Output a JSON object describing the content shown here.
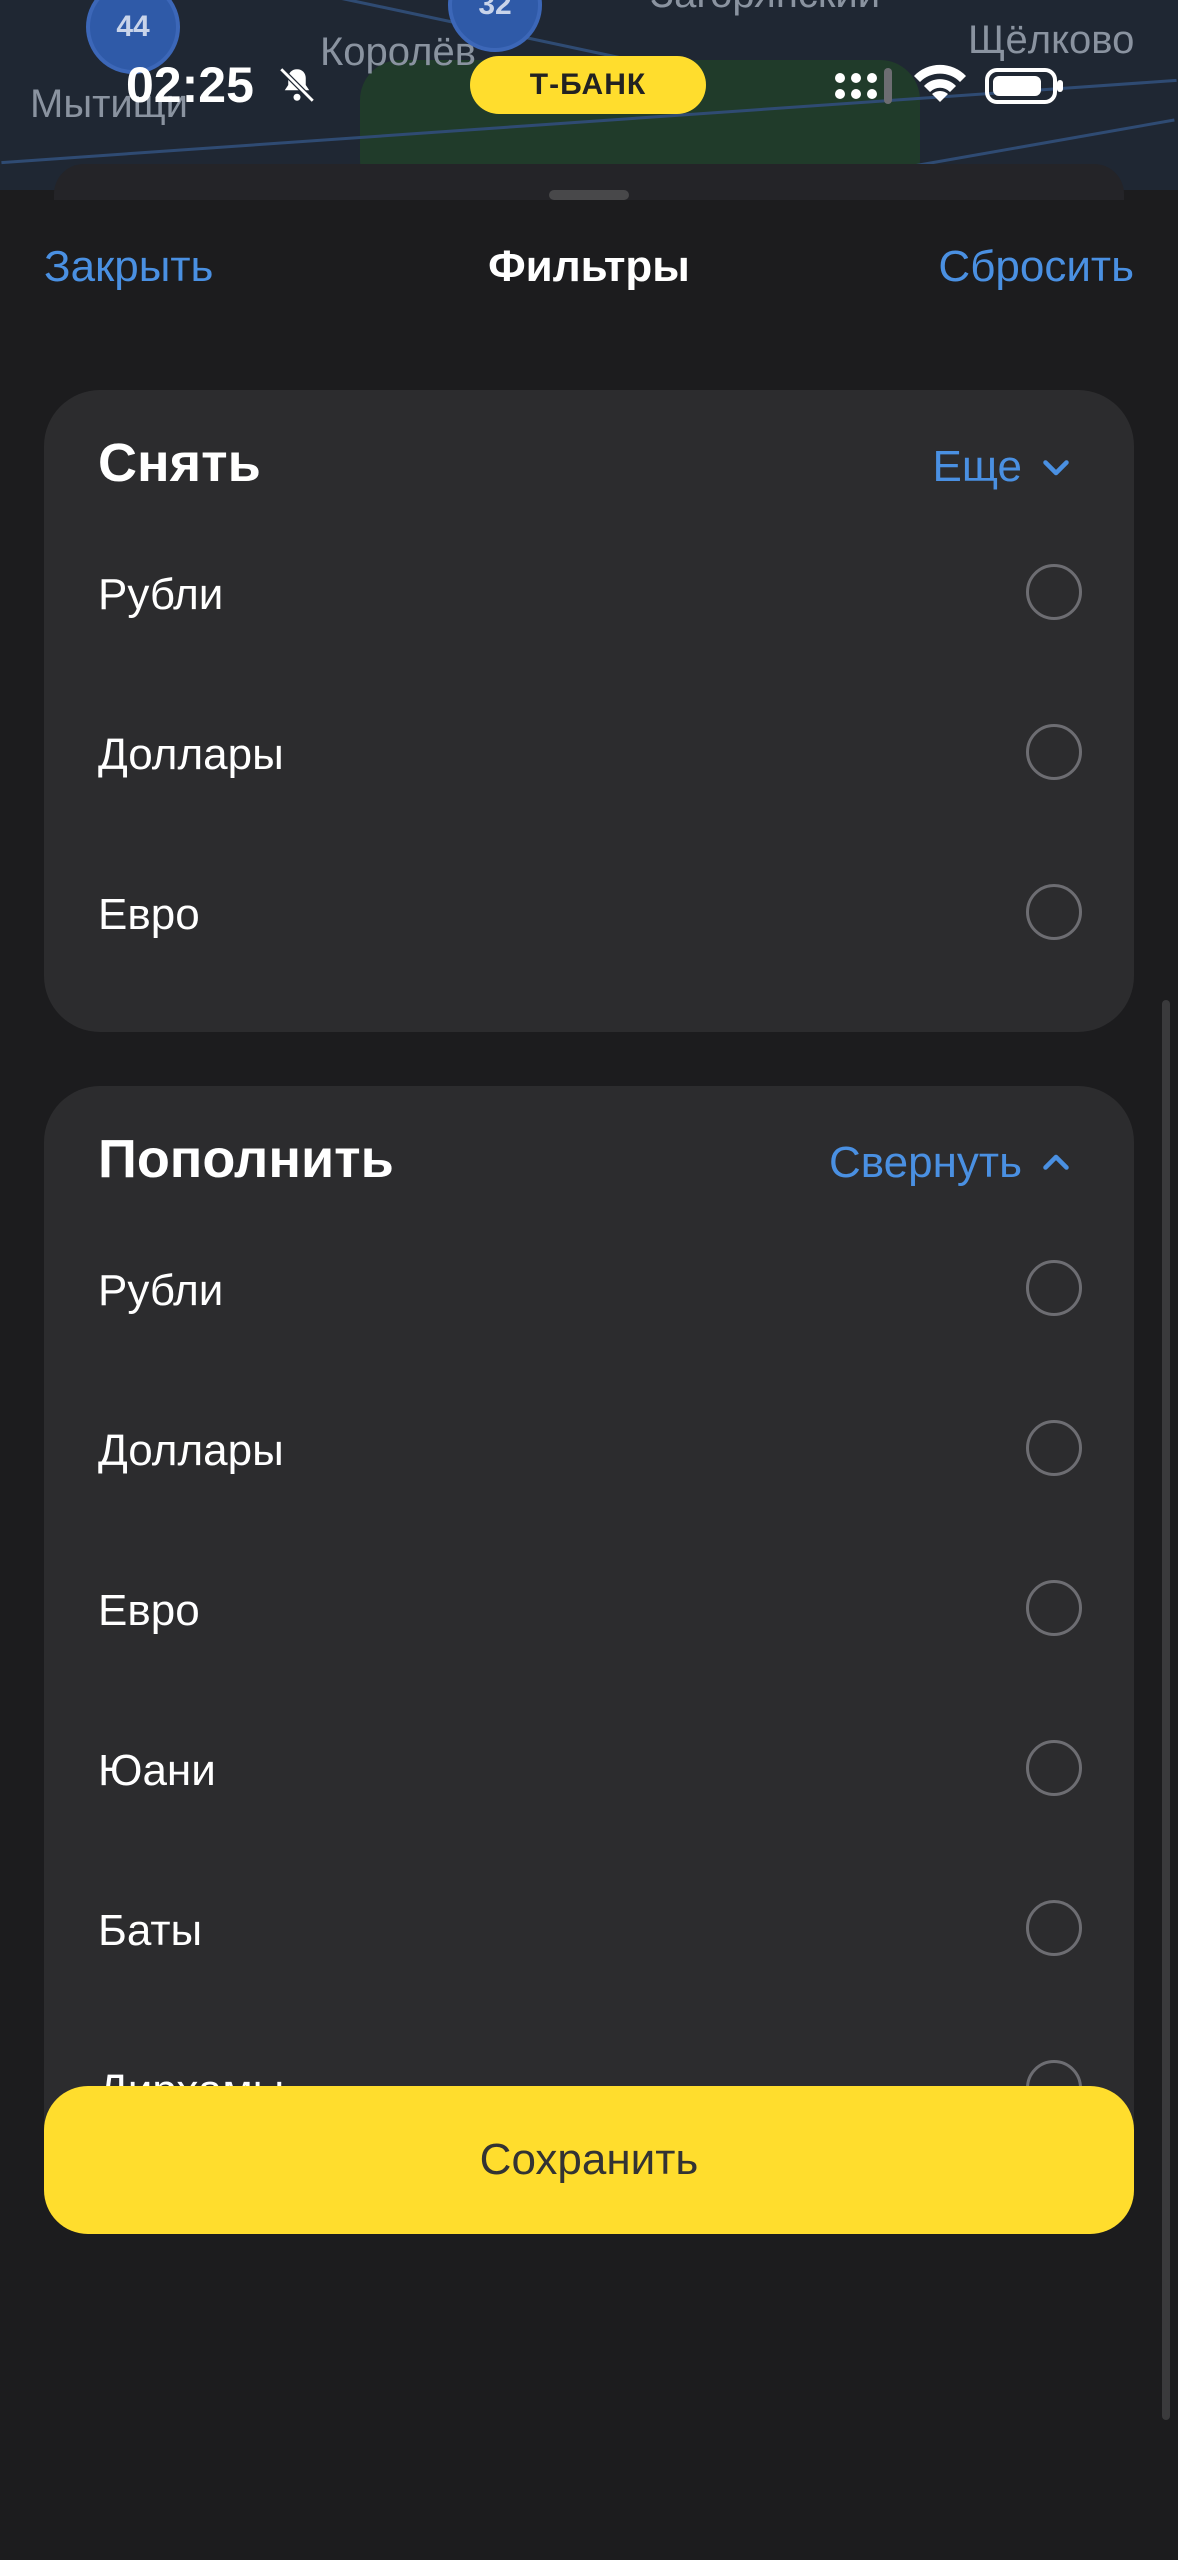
{
  "map": {
    "labels": [
      "Мытищи",
      "Королёв",
      "Щёлково",
      "Загорянский"
    ],
    "pins": [
      "44",
      "32"
    ]
  },
  "status_bar": {
    "time": "02:25",
    "brand": "Т-БАНК"
  },
  "nav": {
    "close": "Закрыть",
    "title": "Фильтры",
    "reset": "Сбросить"
  },
  "withdraw": {
    "title": "Снять",
    "action": "Еще",
    "options": [
      "Рубли",
      "Доллары",
      "Евро"
    ]
  },
  "deposit": {
    "title": "Пополнить",
    "action": "Свернуть",
    "options": [
      "Рубли",
      "Доллары",
      "Евро",
      "Юани",
      "Баты",
      "Дирхамы"
    ]
  },
  "save_label": "Сохранить",
  "colors": {
    "accent": "#4a90e2",
    "brand_yellow": "#ffdd2d",
    "background": "#1c1c1e",
    "card": "#2c2c2e"
  }
}
